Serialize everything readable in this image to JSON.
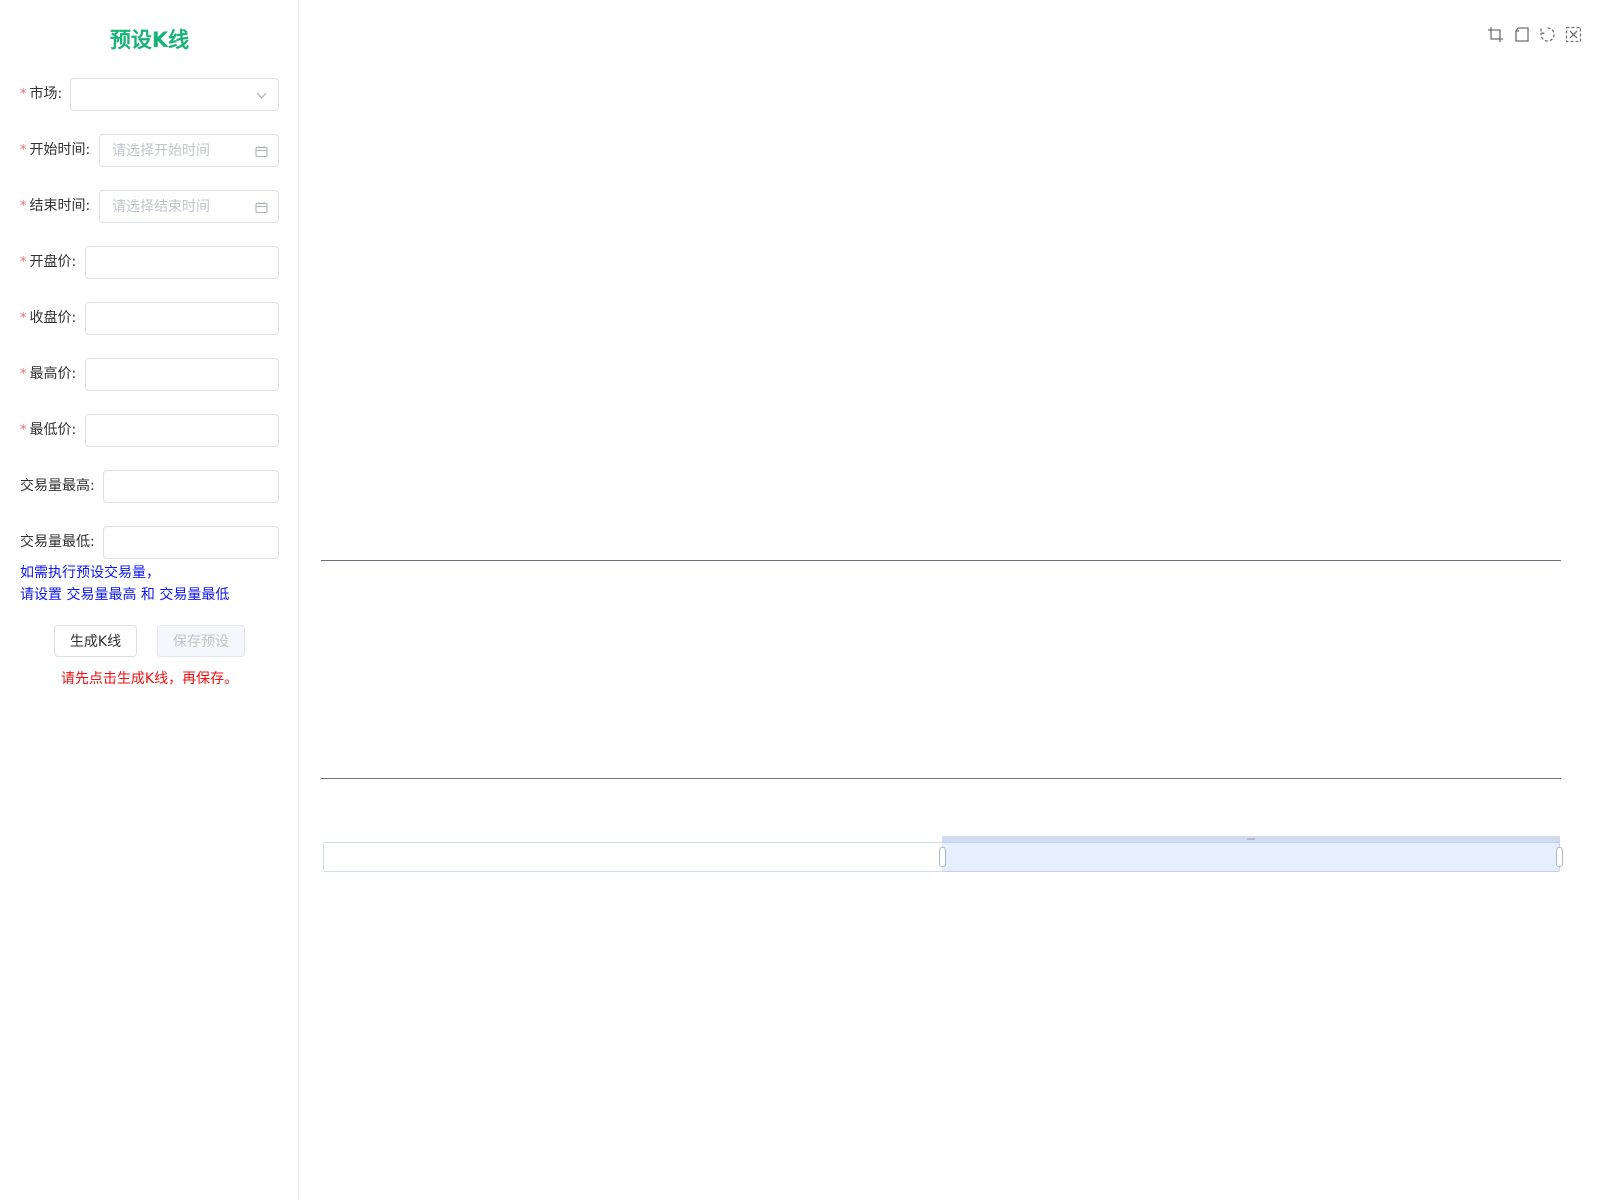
{
  "sidebar": {
    "title": "预设K线",
    "form": {
      "market": {
        "label": "市场:",
        "required": true,
        "value": ""
      },
      "start_time": {
        "label": "开始时间:",
        "required": true,
        "placeholder": "请选择开始时间",
        "value": ""
      },
      "end_time": {
        "label": "结束时间:",
        "required": true,
        "placeholder": "请选择结束时间",
        "value": ""
      },
      "open_price": {
        "label": "开盘价:",
        "required": true,
        "value": ""
      },
      "close_price": {
        "label": "收盘价:",
        "required": true,
        "value": ""
      },
      "high_price": {
        "label": "最高价:",
        "required": true,
        "value": ""
      },
      "low_price": {
        "label": "最低价:",
        "required": true,
        "value": ""
      },
      "volume_high": {
        "label": "交易量最高:",
        "required": false,
        "value": ""
      },
      "volume_low": {
        "label": "交易量最低:",
        "required": false,
        "value": ""
      },
      "required_mark": "*"
    },
    "hint_line1": "如需执行预设交易量，",
    "hint_line2": "请设置 交易量最高 和 交易量最低",
    "generate_label": "生成K线",
    "save_label": "保存预设",
    "warning": "请先点击生成K线，再保存。"
  },
  "chart": {
    "toolbox_icons": [
      "crop-zoom-icon",
      "zoom-reset-icon",
      "restore-icon",
      "save-image-icon"
    ],
    "data_zoom": {
      "start_percent": 50,
      "end_percent": 100
    },
    "colors": {
      "accent": "#19b277",
      "hint": "#0c16f0",
      "warning": "#f01010",
      "zoom_fill": "#87afff"
    }
  }
}
